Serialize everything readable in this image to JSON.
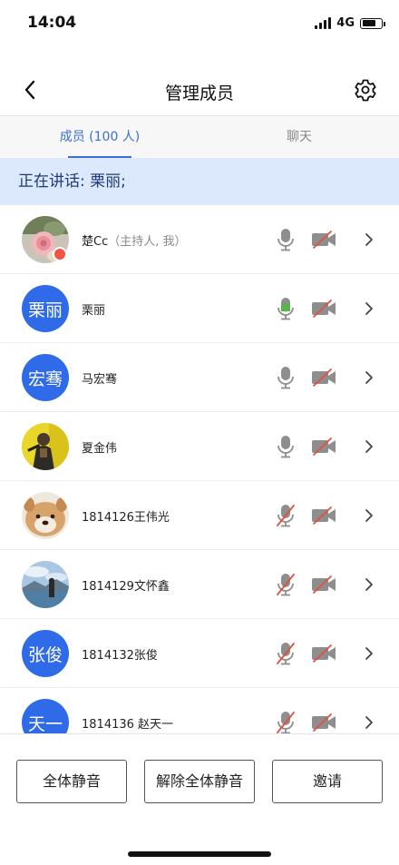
{
  "status": {
    "time": "14:04",
    "network": "4G"
  },
  "nav": {
    "title": "管理成员",
    "back_icon": "back-chevron-icon",
    "settings_icon": "gear-icon"
  },
  "tabs": [
    {
      "label": "成员 (100 人)",
      "active": true
    },
    {
      "label": "聊天",
      "active": false
    }
  ],
  "speaking": "正在讲话: 栗丽;",
  "members": [
    {
      "name": "楚Cc",
      "sub": "（主持人, 我）",
      "avatar_text": "",
      "avatar": "rose-photo",
      "host": true,
      "mic": "on",
      "cam": "off"
    },
    {
      "name": "栗丽",
      "sub": "",
      "avatar_text": "栗丽",
      "avatar": "text",
      "host": false,
      "mic": "speaking",
      "cam": "off"
    },
    {
      "name": "马宏骞",
      "sub": "",
      "avatar_text": "宏骞",
      "avatar": "text",
      "host": false,
      "mic": "on",
      "cam": "off"
    },
    {
      "name": "夏金伟",
      "sub": "",
      "avatar_text": "",
      "avatar": "game-character-photo",
      "host": false,
      "mic": "on",
      "cam": "off"
    },
    {
      "name": "1814126王伟光",
      "sub": "",
      "avatar_text": "",
      "avatar": "dog-photo",
      "host": false,
      "mic": "muted",
      "cam": "off"
    },
    {
      "name": "1814129文怀鑫",
      "sub": "",
      "avatar_text": "",
      "avatar": "lake-photo",
      "host": false,
      "mic": "muted",
      "cam": "off"
    },
    {
      "name": "1814132张俊",
      "sub": "",
      "avatar_text": "张俊",
      "avatar": "text",
      "host": false,
      "mic": "muted",
      "cam": "off"
    },
    {
      "name": "1814136 赵天一",
      "sub": "",
      "avatar_text": "天一",
      "avatar": "text",
      "host": false,
      "mic": "muted",
      "cam": "off"
    }
  ],
  "buttons": {
    "mute_all": "全体静音",
    "unmute_all": "解除全体静音",
    "invite": "邀请"
  },
  "colors": {
    "accent": "#3b6fd6",
    "avatar_blue": "#2f6be8",
    "speaking_banner": "#dce8fb",
    "mic_active": "#55b84a",
    "muted_red": "#e3503f"
  }
}
